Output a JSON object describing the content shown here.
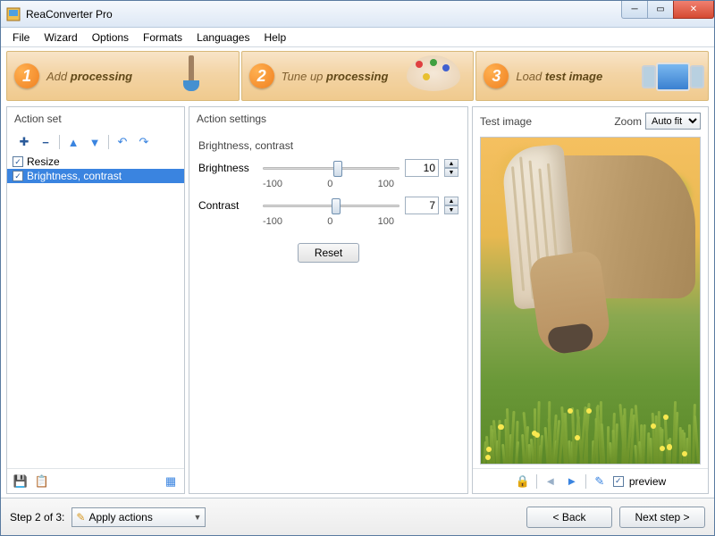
{
  "window": {
    "title": "ReaConverter Pro"
  },
  "menu": {
    "file": "File",
    "wizard": "Wizard",
    "options": "Options",
    "formats": "Formats",
    "languages": "Languages",
    "help": "Help"
  },
  "steps": {
    "s1_pre": "Add ",
    "s1_b": "processing",
    "s2_pre": "Tune up ",
    "s2_b": "processing",
    "s3_pre": "Load ",
    "s3_b": "test image"
  },
  "left": {
    "header": "Action set",
    "items": [
      {
        "label": "Resize",
        "checked": true,
        "selected": false
      },
      {
        "label": "Brightness, contrast",
        "checked": true,
        "selected": true
      }
    ]
  },
  "mid": {
    "header": "Action settings",
    "group": "Brightness, contrast",
    "brightness_label": "Brightness",
    "brightness_value": "10",
    "contrast_label": "Contrast",
    "contrast_value": "7",
    "tick_min": "-100",
    "tick_mid": "0",
    "tick_max": "100",
    "reset": "Reset"
  },
  "right": {
    "header": "Test image",
    "zoom_label": "Zoom",
    "zoom_value": "Auto fit",
    "preview": "preview"
  },
  "bottom": {
    "step": "Step 2 of 3:",
    "combo": "Apply actions",
    "back": "< Back",
    "next": "Next step >"
  }
}
